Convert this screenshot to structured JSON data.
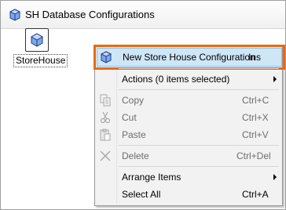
{
  "window": {
    "title": "SH Database Configurations"
  },
  "item": {
    "label": "StoreHouse"
  },
  "menu": {
    "new_label": "New Store House Configuration",
    "new_shortcut": "Ins",
    "actions_label": "Actions (0 items selected)",
    "copy_label": "Copy",
    "copy_shortcut": "Ctrl+C",
    "cut_label": "Cut",
    "cut_shortcut": "Ctrl+X",
    "paste_label": "Paste",
    "paste_shortcut": "Ctrl+V",
    "delete_label": "Delete",
    "delete_shortcut": "Ctrl+Del",
    "arrange_label": "Arrange Items",
    "select_all_label": "Select All",
    "select_all_shortcut": "Ctrl+A"
  },
  "colors": {
    "highlight_outline": "#e86a10",
    "highlight_fill": "#cfe6f7"
  }
}
